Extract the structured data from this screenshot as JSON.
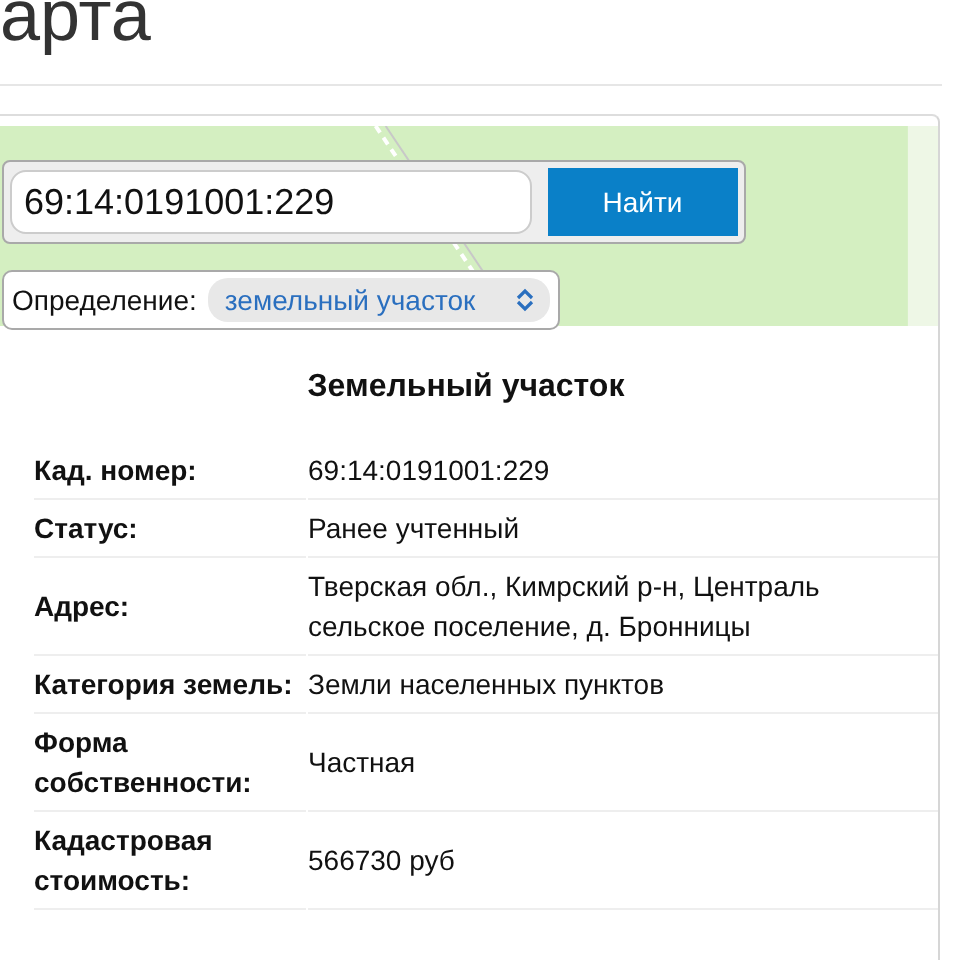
{
  "page_title": "арта",
  "search": {
    "value": "69:14:0191001:229",
    "button": "Найти"
  },
  "definition": {
    "label": "Определение:",
    "value": "земельный участок"
  },
  "card": {
    "title": "Земельный участок",
    "rows": [
      {
        "label": "Кад. номер:",
        "lines": [
          "69:14:0191001:229"
        ]
      },
      {
        "label": "Статус:",
        "lines": [
          "Ранее учтенный"
        ]
      },
      {
        "label": "Адрес:",
        "lines": [
          "Тверская обл., Кимрский р-н, Централь",
          "сельское поселение, д. Бронницы"
        ]
      },
      {
        "label": "Категория земель:",
        "lines": [
          "Земли населенных пунктов"
        ]
      },
      {
        "label": "Форма собственности:",
        "lines": [
          "Частная"
        ]
      },
      {
        "label": "Кадастровая стоимость:",
        "lines": [
          "566730 руб"
        ]
      }
    ]
  }
}
